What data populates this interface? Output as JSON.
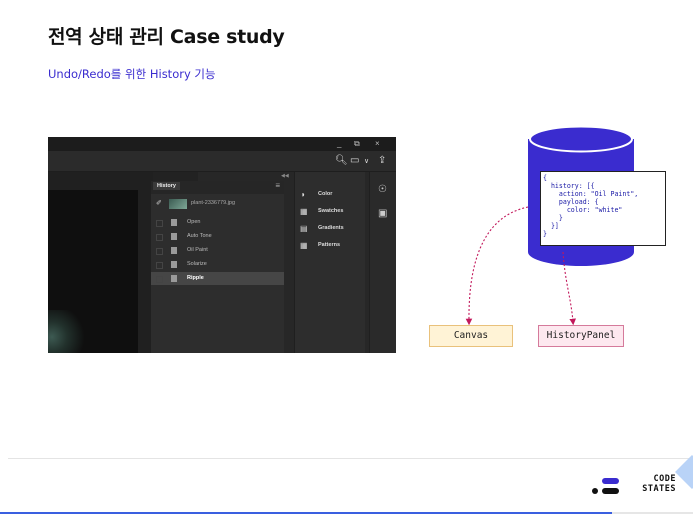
{
  "page": {
    "title": "전역 상태 관리 Case study",
    "subtitle": "Undo/Redo를 위한 History 기능"
  },
  "screenshot": {
    "window_controls": [
      "_",
      "⧉",
      "×"
    ],
    "history_panel": {
      "tab_label": "History",
      "snapshot_label": "plant-2336779.jpg",
      "items": [
        {
          "label": "Open",
          "active": false
        },
        {
          "label": "Auto Tone",
          "active": false
        },
        {
          "label": "Oil Paint",
          "active": false
        },
        {
          "label": "Solarize",
          "active": false
        },
        {
          "label": "Ripple",
          "active": true
        }
      ]
    },
    "side_panels": [
      {
        "label": "Color",
        "icon": "palette-icon"
      },
      {
        "label": "Swatches",
        "icon": "grid-icon"
      },
      {
        "label": "Gradients",
        "icon": "gradient-icon"
      },
      {
        "label": "Patterns",
        "icon": "grid-icon"
      }
    ]
  },
  "diagram": {
    "code_lines": [
      "{",
      "  history: [{",
      "    action: \"Oil Paint\",",
      "    payload: {",
      "      color: \"white\"",
      "    }",
      "  }]",
      "}"
    ],
    "canvas_label": "Canvas",
    "history_panel_label": "HistoryPanel",
    "colors": {
      "store": "#3a2ccf",
      "arrow": "#c2185b",
      "canvas_fill": "#fff3d6",
      "history_fill": "#fde8ef"
    }
  },
  "footer": {
    "logo_top": "CODE",
    "logo_bottom": "STATES"
  }
}
